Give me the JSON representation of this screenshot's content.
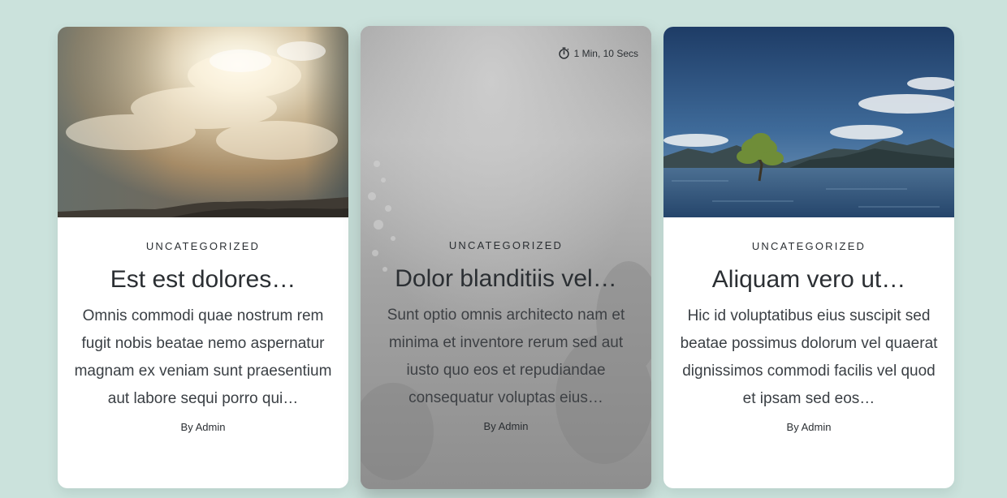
{
  "posts": [
    {
      "image_icon": "sunlit-clouds-image",
      "category": "UNCATEGORIZED",
      "title": "Est est dolores…",
      "excerpt": "Omnis commodi quae nostrum rem fugit nobis beatae nemo aspernatur magnam ex veniam sunt praesentium aut labore sequi porro qui…",
      "author": "By Admin"
    },
    {
      "image_icon": "underwater-image",
      "read_time": "1 Min, 10 Secs",
      "read_time_icon": "stopwatch-icon",
      "category": "UNCATEGORIZED",
      "title": "Dolor blanditiis vel…",
      "excerpt": "Sunt optio omnis architecto nam et minima et inventore rerum sed aut iusto quo eos et repudiandae consequatur voluptas eius…",
      "author": "By Admin"
    },
    {
      "image_icon": "lake-tree-image",
      "category": "UNCATEGORIZED",
      "title": "Aliquam vero ut…",
      "excerpt": "Hic id voluptatibus eius suscipit sed beatae possimus dolorum vel quaerat dignissimos commodi facilis vel quod et ipsam sed eos…",
      "author": "By Admin"
    }
  ],
  "colors": {
    "page_background": "#cbe2dc",
    "card_background": "#ffffff",
    "text": "#2b2f33"
  }
}
